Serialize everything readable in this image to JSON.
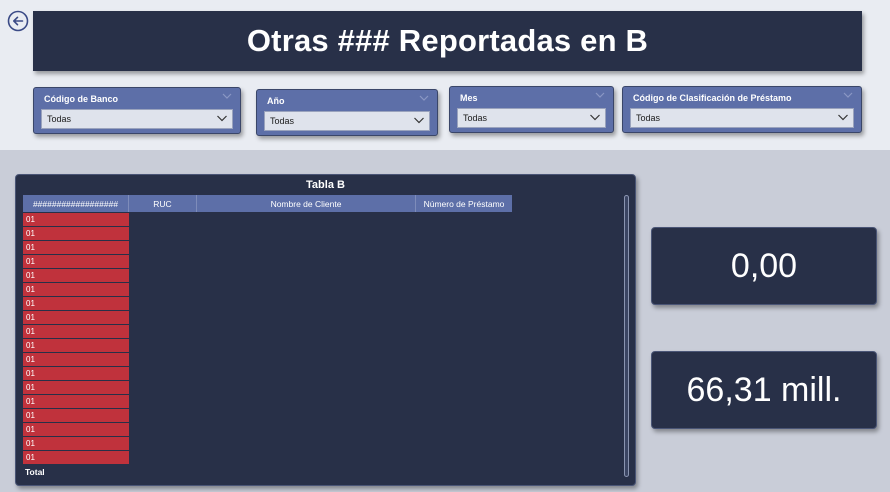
{
  "header": {
    "title": "Otras ### Reportadas en B"
  },
  "filters": [
    {
      "label": "Código de Banco",
      "value": "Todas"
    },
    {
      "label": "Año",
      "value": "Todas"
    },
    {
      "label": "Mes",
      "value": "Todas"
    },
    {
      "label": "Código de Clasificación de Préstamo",
      "value": "Todas"
    }
  ],
  "table": {
    "title": "Tabla B",
    "columns": [
      "##################",
      "RUC",
      "Nombre de Cliente",
      "Número de Préstamo"
    ],
    "rows": [
      "01",
      "01",
      "01",
      "01",
      "01",
      "01",
      "01",
      "01",
      "01",
      "01",
      "01",
      "01",
      "01",
      "01",
      "01",
      "01",
      "01",
      "01"
    ],
    "total_label": "Total"
  },
  "kpis": [
    {
      "value": "0,00"
    },
    {
      "value": "66,31 mill."
    }
  ],
  "colors": {
    "title_bg": "#283048",
    "slicer_bg": "#5d6fa8",
    "row_highlight": "#c0323c",
    "canvas_bottom": "#c9cdd8"
  },
  "icons": {
    "back": "back-arrow-icon",
    "dropdown": "chevron-down-icon"
  }
}
